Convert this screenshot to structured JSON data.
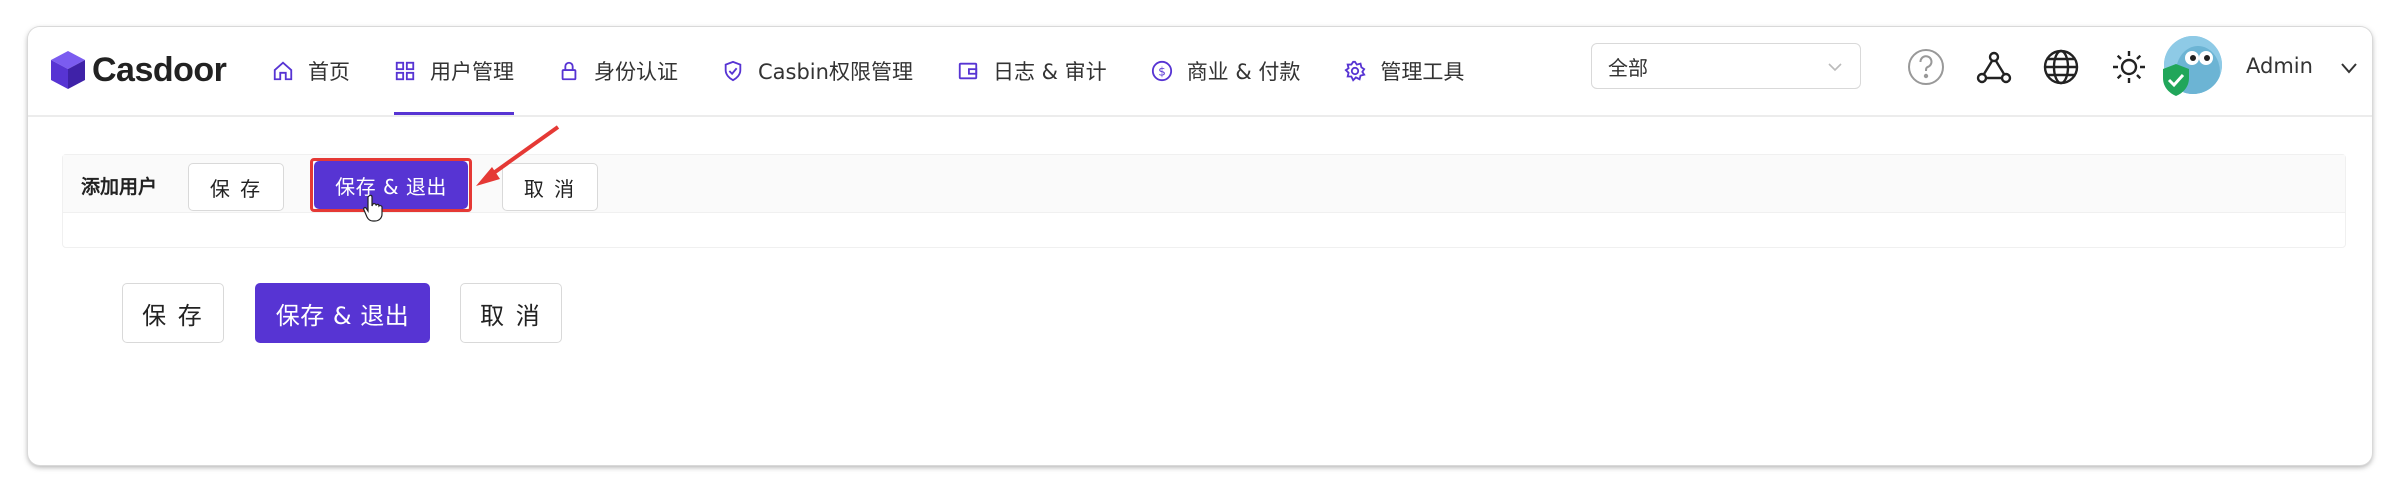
{
  "app": {
    "brand": "Casdoor"
  },
  "nav": [
    {
      "label": "首页",
      "icon": "home-icon",
      "active": false
    },
    {
      "label": "用户管理",
      "icon": "grid-icon",
      "active": true
    },
    {
      "label": "身份认证",
      "icon": "lock-icon",
      "active": false
    },
    {
      "label": "Casbin权限管理",
      "icon": "shield-check-icon",
      "active": false
    },
    {
      "label": "日志 & 审计",
      "icon": "wallet-icon",
      "active": false
    },
    {
      "label": "商业 & 付款",
      "icon": "dollar-icon",
      "active": false
    },
    {
      "label": "管理工具",
      "icon": "gear-icon",
      "active": false
    }
  ],
  "org_select": {
    "value": "全部"
  },
  "user": {
    "name": "Admin"
  },
  "card": {
    "title": "添加用户",
    "save": "保 存",
    "save_exit": "保存 & 退出",
    "cancel": "取 消"
  },
  "footer_buttons": {
    "save": "保 存",
    "save_exit": "保存 & 退出",
    "cancel": "取 消"
  },
  "colors": {
    "accent": "#5734d3",
    "highlight": "#e53935"
  }
}
